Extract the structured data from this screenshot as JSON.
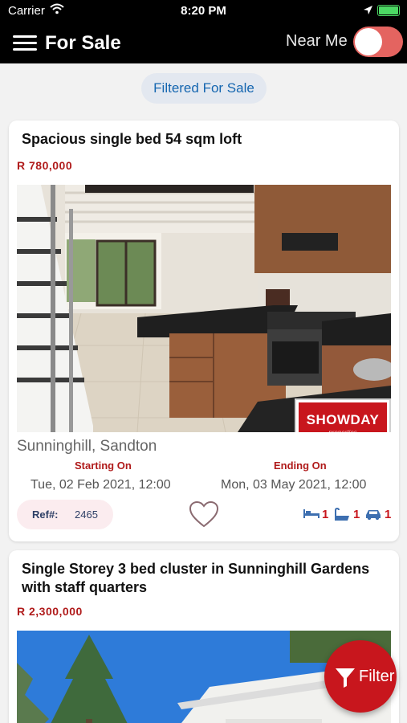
{
  "status_bar": {
    "carrier": "Carrier",
    "time": "8:20 PM"
  },
  "nav": {
    "title": "For Sale",
    "near_me_label": "Near Me",
    "near_me_on": true
  },
  "filter_chip": {
    "label": "Filtered For Sale"
  },
  "listings": [
    {
      "title": "Spacious single bed 54 sqm loft",
      "price": "R 780,000",
      "photo_badge": {
        "brand": "SHOWDAY",
        "sub": "properties"
      },
      "location": "Sunninghill, Sandton",
      "starting_label": "Starting On",
      "starting_value": "Tue, 02 Feb 2021, 12:00",
      "ending_label": "Ending On",
      "ending_value": "Mon, 03 May 2021, 12:00",
      "ref_label": "Ref#:",
      "ref_value": "2465",
      "beds": "1",
      "baths": "1",
      "garages": "1"
    },
    {
      "title": "Single Storey 3 bed cluster in Sunninghill Gardens with staff quarters",
      "price": "R 2,300,000"
    }
  ],
  "fab": {
    "label": "Filter"
  },
  "colors": {
    "accent": "#c8161d",
    "nav_bg": "#000000",
    "chip_text": "#1566b0",
    "toggle_on": "#e46460"
  },
  "icons": [
    "wifi-icon",
    "location-arrow-icon",
    "battery-icon",
    "menu-icon",
    "heart-icon",
    "bed-icon",
    "bath-icon",
    "car-icon",
    "filter-funnel-icon"
  ]
}
